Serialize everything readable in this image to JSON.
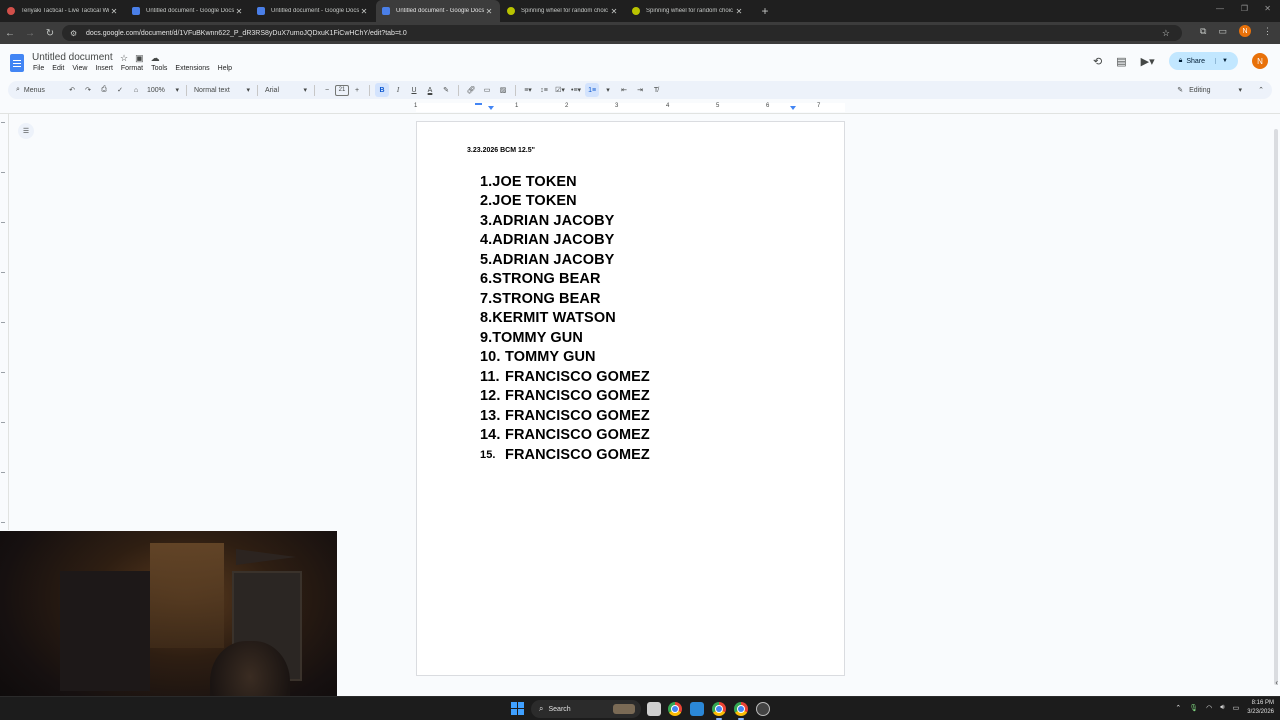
{
  "browser": {
    "tabs": [
      {
        "title": "Teriyaki Tactical - Live Tactical Wri",
        "icon": "teriyaki-favicon",
        "active": false
      },
      {
        "title": "Untitled document - Google Docs",
        "icon": "docs-favicon",
        "active": false
      },
      {
        "title": "Untitled document - Google Docs",
        "icon": "docs-favicon",
        "active": false
      },
      {
        "title": "Untitled document - Google Docs",
        "icon": "docs-favicon",
        "active": true
      },
      {
        "title": "Spinning wheel for random choic",
        "icon": "wheel-favicon",
        "active": false
      },
      {
        "title": "Spinning wheel for random choic",
        "icon": "wheel-favicon",
        "active": false
      }
    ],
    "url": "docs.google.com/document/d/1VFuBKwnn622_P_dR3RS8yDuX7umoJQDxuK1FiCwHChY/edit?tab=t.0",
    "profile_initial": "N"
  },
  "docs": {
    "title": "Untitled document",
    "menu": [
      "File",
      "Edit",
      "View",
      "Insert",
      "Format",
      "Tools",
      "Extensions",
      "Help"
    ],
    "share_label": "Share",
    "avatar_initial": "N",
    "toolbar": {
      "menus_label": "Menus",
      "zoom": "100%",
      "style": "Normal text",
      "font": "Arial",
      "font_size": "21",
      "mode": "Editing"
    },
    "ruler_numbers": [
      "1",
      "1",
      "2",
      "3",
      "4",
      "5",
      "6",
      "7"
    ]
  },
  "document": {
    "heading": "3.23.2026 BCM 12.5\"",
    "entries": [
      {
        "num": "1.",
        "name": "JOE TOKEN"
      },
      {
        "num": "2.",
        "name": "JOE TOKEN"
      },
      {
        "num": "3.",
        "name": "ADRIAN JACOBY"
      },
      {
        "num": "4.",
        "name": "ADRIAN JACOBY"
      },
      {
        "num": "5.",
        "name": "ADRIAN JACOBY"
      },
      {
        "num": "6.",
        "name": "STRONG BEAR"
      },
      {
        "num": "7.",
        "name": "STRONG BEAR"
      },
      {
        "num": "8.",
        "name": "KERMIT WATSON"
      },
      {
        "num": "9.",
        "name": "TOMMY GUN"
      },
      {
        "num": "10.",
        "name": "TOMMY GUN"
      },
      {
        "num": "11.",
        "name": "FRANCISCO GOMEZ"
      },
      {
        "num": "12.",
        "name": "FRANCISCO GOMEZ"
      },
      {
        "num": "13.",
        "name": "FRANCISCO GOMEZ"
      },
      {
        "num": "14.",
        "name": "FRANCISCO GOMEZ"
      },
      {
        "num": "15.",
        "name": "FRANCISCO GOMEZ"
      }
    ]
  },
  "taskbar": {
    "search_label": "Search",
    "time": "8:16 PM",
    "date": "3/23/2026"
  },
  "colors": {
    "docs_blue": "#4285f4",
    "share_bg": "#c2e7ff",
    "toolbar_bg": "#edf2fa",
    "avatar": "#e8710a"
  }
}
